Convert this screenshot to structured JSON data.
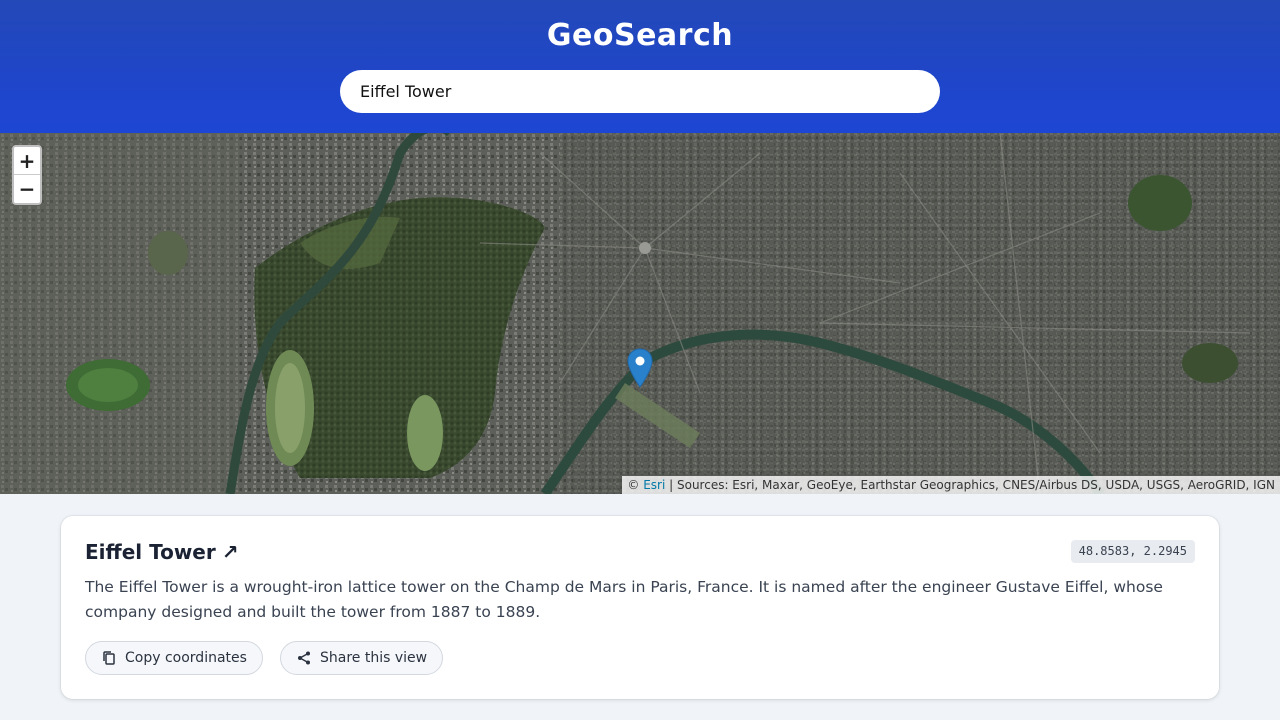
{
  "header": {
    "title": "GeoSearch",
    "search_value": "Eiffel Tower"
  },
  "map": {
    "zoom_in_label": "+",
    "zoom_out_label": "−",
    "attribution_prefix": "© ",
    "attribution_link": "Esri",
    "attribution_rest": " | Sources: Esri, Maxar, GeoEye, Earthstar Geographics, CNES/Airbus DS, USDA, USGS, AeroGRID, IGN",
    "marker_color": "#2a81cb"
  },
  "result": {
    "title": "Eiffel Tower",
    "external_icon": "↗",
    "coordinates": "48.8583, 2.2945",
    "description": "The Eiffel Tower is a wrought-iron lattice tower on the Champ de Mars in Paris, France. It is named after the engineer Gustave Eiffel, whose company designed and built the tower from 1887 to 1889.",
    "copy_label": "Copy coordinates",
    "share_label": "Share this view"
  },
  "colors": {
    "header_blue": "#1f46c9",
    "page_background": "#f0f4f8",
    "link_blue": "#0078a8"
  }
}
